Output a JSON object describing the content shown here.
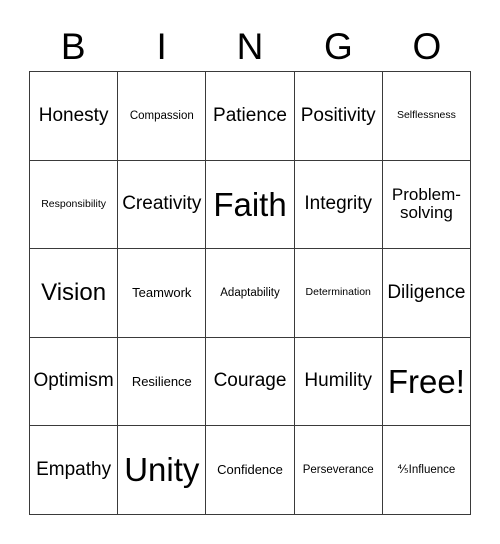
{
  "card": {
    "title": "BINGO",
    "header_letters": [
      "B",
      "I",
      "N",
      "G",
      "O"
    ],
    "free_space_label": "Free!",
    "rows": [
      [
        {
          "label": "Honesty",
          "size": "fs-md"
        },
        {
          "label": "Compassion",
          "size": "fs-xxs"
        },
        {
          "label": "Patience",
          "size": "fs-md"
        },
        {
          "label": "Positivity",
          "size": "fs-md"
        },
        {
          "label": "Selflessness",
          "size": "fs-tiny"
        }
      ],
      [
        {
          "label": "Responsibility",
          "size": "fs-tiny"
        },
        {
          "label": "Creativity",
          "size": "fs-md"
        },
        {
          "label": "Faith",
          "size": "fs-xl"
        },
        {
          "label": "Integrity",
          "size": "fs-md"
        },
        {
          "label": "Problem-solving",
          "size": "fs-sm"
        }
      ],
      [
        {
          "label": "Vision",
          "size": "fs-lg"
        },
        {
          "label": "Teamwork",
          "size": "fs-xs"
        },
        {
          "label": "Adaptability",
          "size": "fs-xxs"
        },
        {
          "label": "Determination",
          "size": "fs-tiny"
        },
        {
          "label": "Diligence",
          "size": "fs-md"
        }
      ],
      [
        {
          "label": "Optimism",
          "size": "fs-md"
        },
        {
          "label": "Resilience",
          "size": "fs-xs"
        },
        {
          "label": "Courage",
          "size": "fs-md"
        },
        {
          "label": "Humility",
          "size": "fs-md"
        },
        {
          "label": "Free!",
          "size": "fs-xl"
        }
      ],
      [
        {
          "label": "Empathy",
          "size": "fs-md"
        },
        {
          "label": "Unity",
          "size": "fs-xl"
        },
        {
          "label": "Confidence",
          "size": "fs-xs"
        },
        {
          "label": "Perseverance",
          "size": "fs-xxs"
        },
        {
          "label": "⅘Influence",
          "size": "fs-xxs"
        }
      ]
    ]
  },
  "colors": {
    "background": "#ffffff",
    "text": "#000000",
    "grid_line": "#3a3a3a"
  }
}
